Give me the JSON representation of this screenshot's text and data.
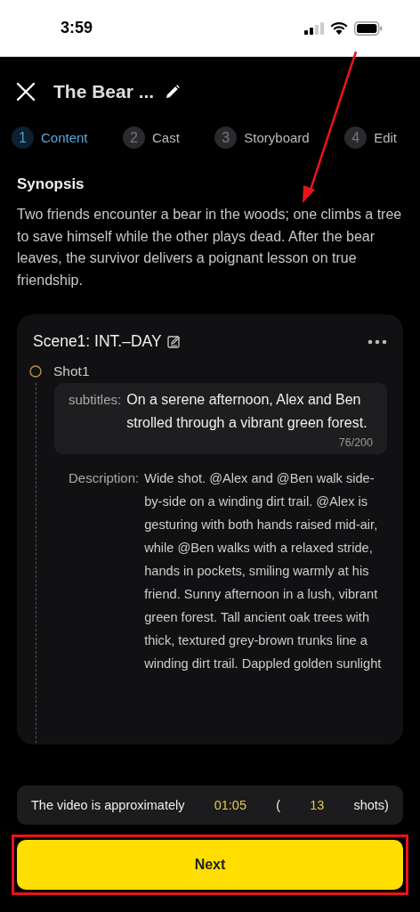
{
  "status_bar": {
    "time": "3:59"
  },
  "header": {
    "title": "The Bear ..."
  },
  "steps": [
    {
      "number": "1",
      "label": "Content",
      "selected": true
    },
    {
      "number": "2",
      "label": "Cast",
      "selected": false
    },
    {
      "number": "3",
      "label": "Storyboard",
      "selected": false
    },
    {
      "number": "4",
      "label": "Edit",
      "selected": false
    }
  ],
  "synopsis": {
    "title": "Synopsis",
    "text": "Two friends encounter a bear in the woods; one climbs a tree to save himself while the other plays dead. After the bear leaves, the survivor delivers a poignant lesson on true friendship."
  },
  "scene": {
    "title": "Scene1: INT.–DAY",
    "shots": [
      {
        "title": "Shot1",
        "subtitles_label": "subtitles:",
        "subtitles": "On a serene afternoon, Alex and Ben strolled through a vibrant green forest.",
        "count": "76/200",
        "description_label": "Description:",
        "description": "Wide shot. @Alex and @Ben walk side-by-side on a winding dirt trail. @Alex is gesturing with both hands raised mid-air, while @Ben walks with a relaxed stride, hands in pockets, smiling warmly at his friend. Sunny afternoon in a lush, vibrant green forest. Tall ancient oak trees with thick, textured grey-brown trunks line a winding dirt trail. Dappled golden sunlight"
      }
    ]
  },
  "summary": {
    "prefix": "The video is approximately",
    "duration": "01:05",
    "open": "(",
    "shots": "13",
    "suffix": "shots)"
  },
  "next_button": {
    "label": "Next"
  },
  "annotation_arrow": {
    "color": "#e8141c"
  },
  "highlight_frame": {
    "color": "#e8141c"
  }
}
